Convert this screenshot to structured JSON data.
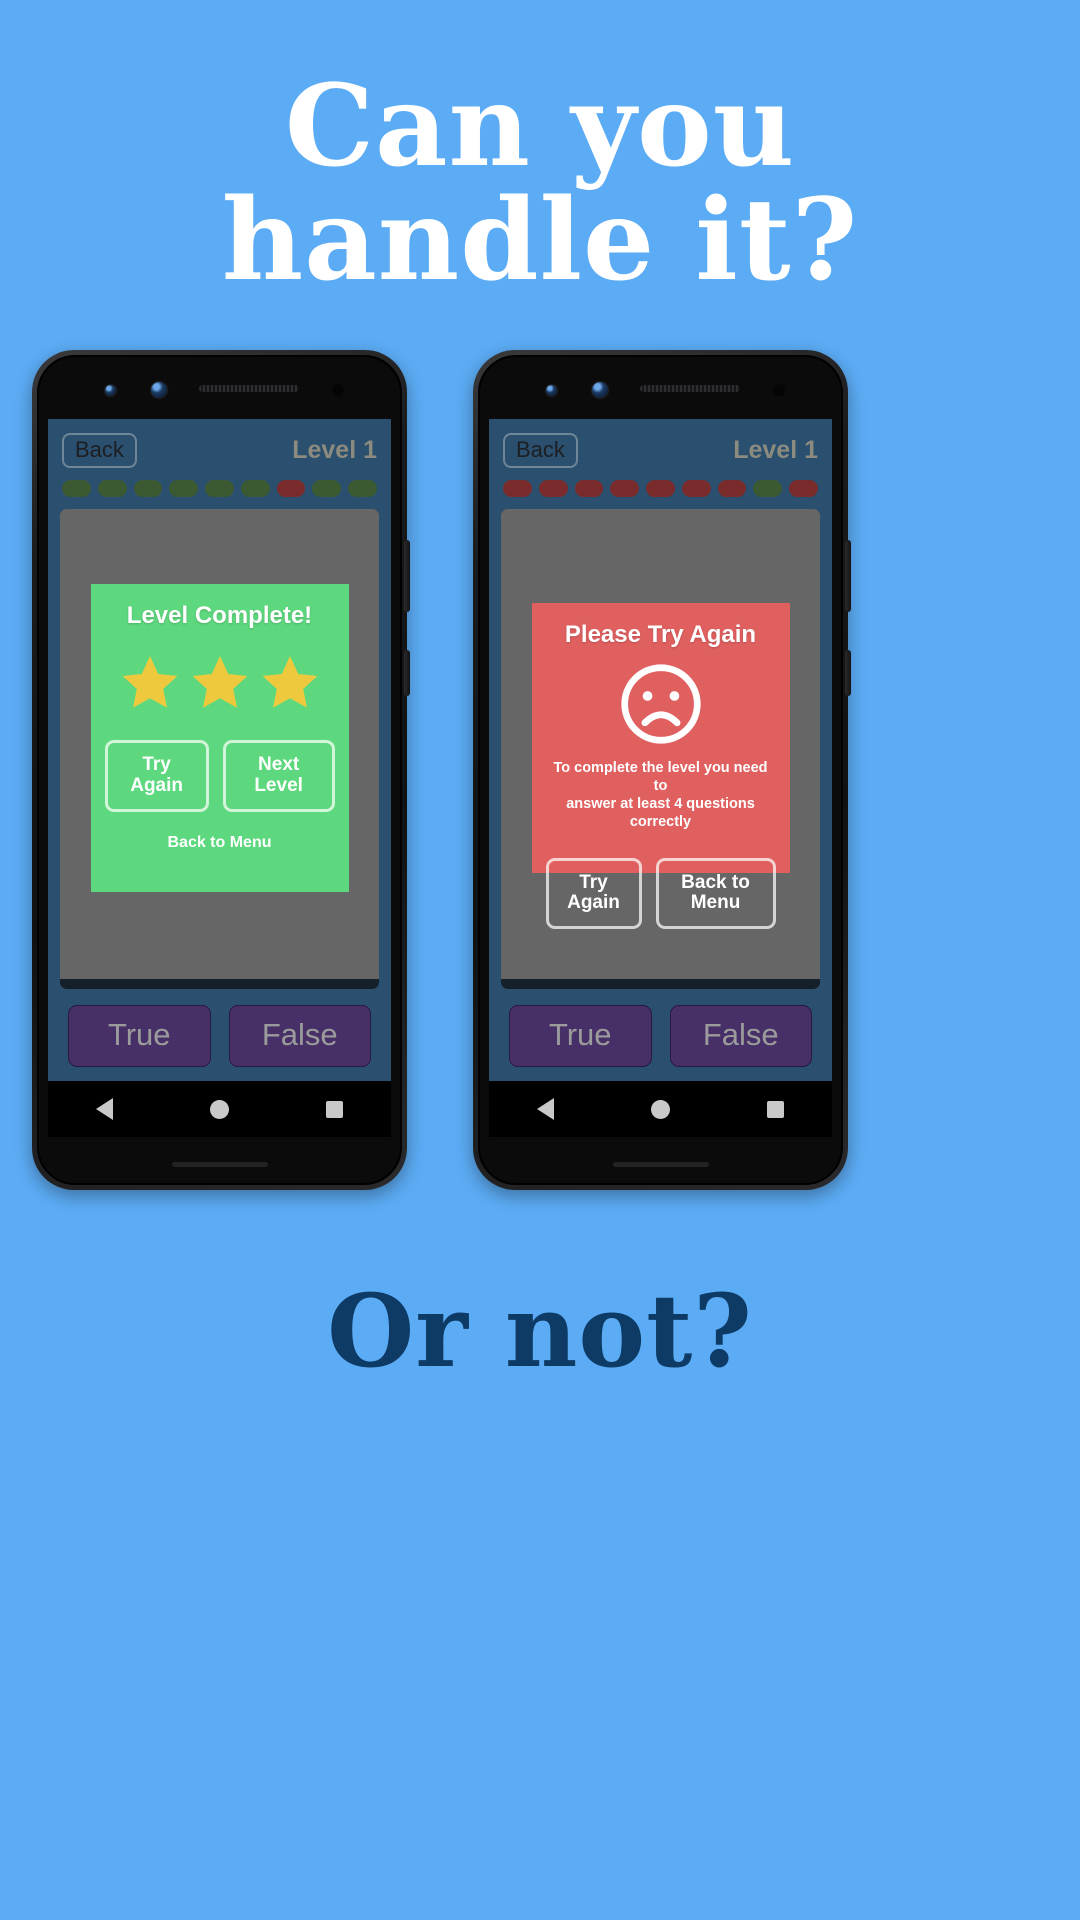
{
  "promo": {
    "headline_line1": "Can you",
    "headline_line2": "handle it?",
    "footline": "Or not?",
    "background_color": "#5cacf5",
    "headline_color": "#ffffff",
    "footline_color": "#0d3b66"
  },
  "phones": [
    {
      "id": "phone-success",
      "header": {
        "back_label": "Back",
        "level_label": "Level 1"
      },
      "progress_pills": [
        "green",
        "green",
        "green",
        "green",
        "green",
        "green",
        "red",
        "green",
        "green"
      ],
      "card": {
        "type": "success",
        "background_color": "#5ed87e",
        "title": "Level Complete!",
        "stars_filled": 3,
        "star_color": "#efc93d",
        "primary_button": "Try Again",
        "secondary_button": "Next Level",
        "link_button": "Back to Menu"
      },
      "answer_buttons": {
        "true_label": "True",
        "false_label": "False"
      },
      "nav_bar": [
        "back-triangle-icon",
        "home-circle-icon",
        "recents-square-icon"
      ]
    },
    {
      "id": "phone-failure",
      "header": {
        "back_label": "Back",
        "level_label": "Level 1"
      },
      "progress_pills": [
        "red",
        "red",
        "red",
        "red",
        "red",
        "red",
        "red",
        "green",
        "red"
      ],
      "card": {
        "type": "failure",
        "background_color": "#e06060",
        "title": "Please Try Again",
        "icon": "sad-face-icon",
        "message_line1": "To complete the level you need to",
        "message_line2": "answer at least 4 questions correctly",
        "primary_button": "Try Again",
        "secondary_button": "Back to Menu"
      },
      "answer_buttons": {
        "true_label": "True",
        "false_label": "False"
      },
      "nav_bar": [
        "back-triangle-icon",
        "home-circle-icon",
        "recents-square-icon"
      ]
    }
  ]
}
